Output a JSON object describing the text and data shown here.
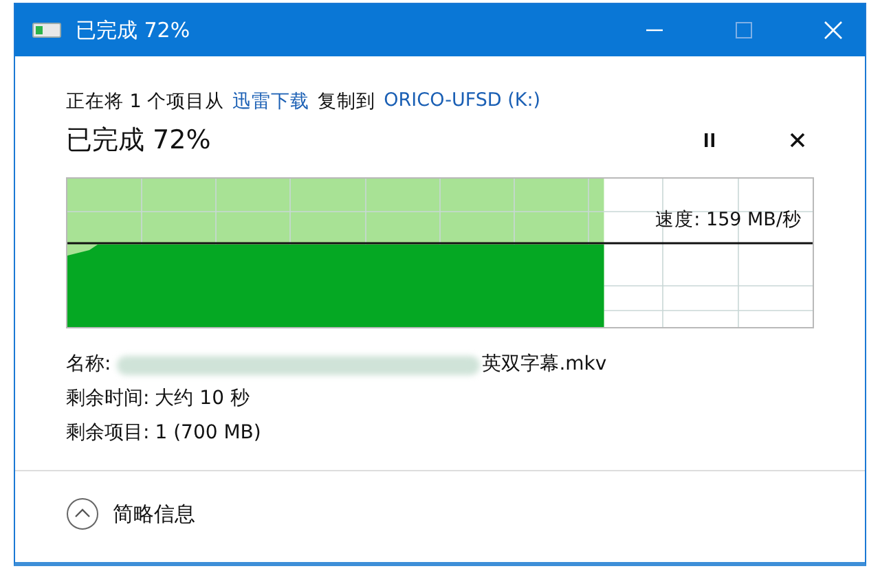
{
  "window": {
    "title": "已完成 72%"
  },
  "copy_line": {
    "prefix": "正在将 1 个项目从",
    "source": "迅雷下载",
    "middle": "复制到",
    "destination": "ORICO-UFSD (K:)"
  },
  "heading": "已完成 72%",
  "progress": {
    "level": 0.72,
    "speed": "速度: 159 MB/秒"
  },
  "details": [
    {
      "label": "名称:",
      "value": "英双字幕.mkv",
      "blurred": true
    },
    {
      "label": "剩余时间:",
      "value": "大约 10 秒",
      "blurred": false
    },
    {
      "label": "剩余项目:",
      "value": "1 (700 MB)",
      "blurred": false
    }
  ],
  "footer": {
    "toggle": "简略信息"
  }
}
